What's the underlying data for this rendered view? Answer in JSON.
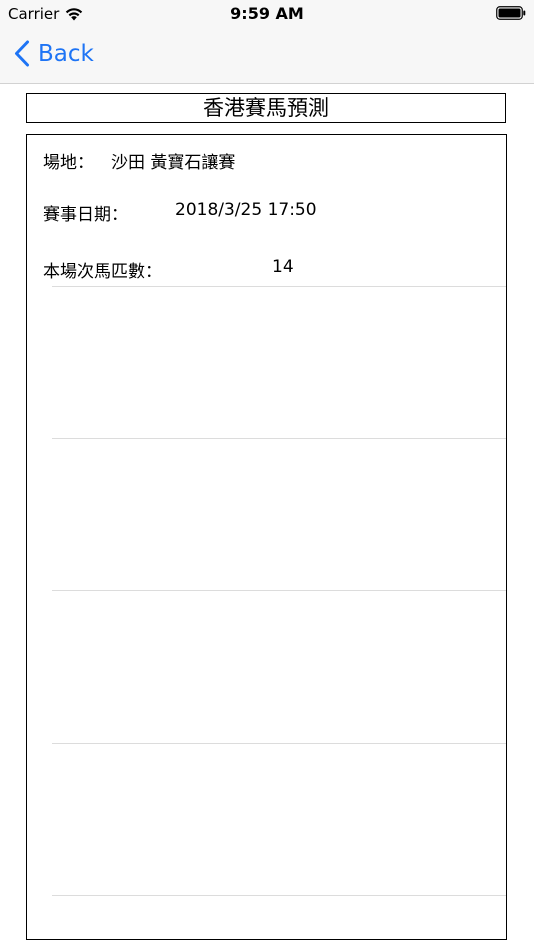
{
  "status_bar": {
    "carrier": "Carrier",
    "time": "9:59 AM"
  },
  "nav": {
    "back_label": "Back"
  },
  "main": {
    "title": "香港賽馬預測",
    "venue_label": "場地：",
    "venue_value": "沙田 黃寶石讓賽",
    "date_label": "賽事日期：",
    "date_value": "2018/3/25 17:50",
    "horses_label": "本場次馬匹數：",
    "horses_value": "14"
  },
  "colors": {
    "accent": "#1e74f5",
    "bar_background": "#f7f7f7"
  }
}
